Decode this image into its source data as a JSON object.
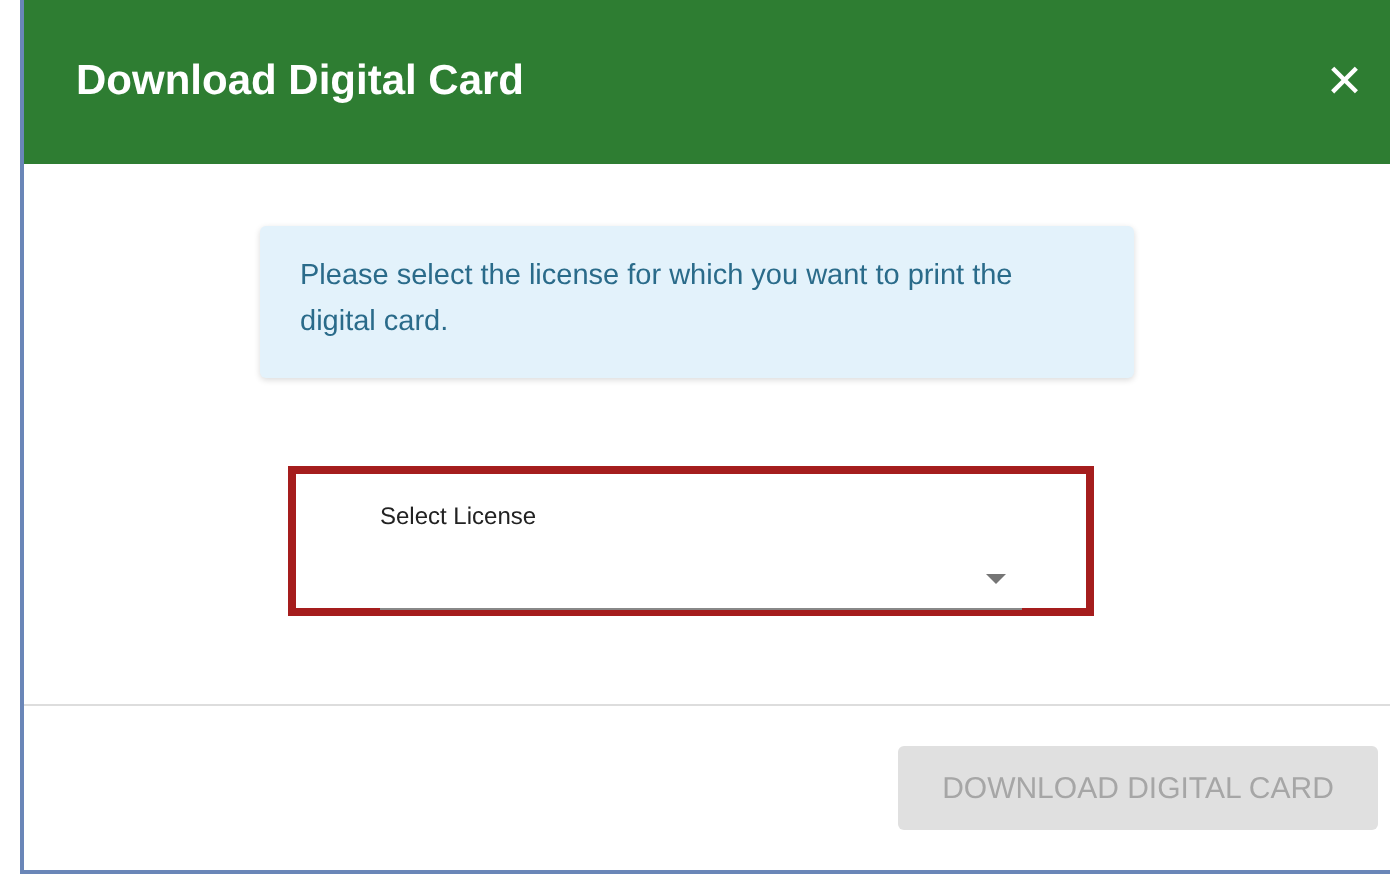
{
  "dialog": {
    "title": "Download Digital Card",
    "close": "×"
  },
  "info": "Please select the license for which you want to print the digital card.",
  "select": {
    "label": "Select License",
    "highlighted": true
  },
  "button": {
    "label": "DOWNLOAD DIGITAL CARD",
    "disabled": true
  }
}
